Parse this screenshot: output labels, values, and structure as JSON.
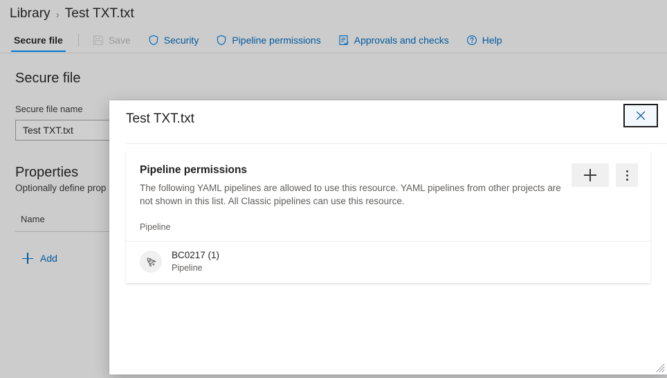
{
  "breadcrumb": {
    "root": "Library",
    "separator": "›",
    "current": "Test TXT.txt"
  },
  "commandbar": {
    "selected_tab": "Secure file",
    "items": [
      {
        "label": "Save",
        "icon": "save-icon",
        "disabled": true
      },
      {
        "label": "Security",
        "icon": "shield-icon",
        "disabled": false
      },
      {
        "label": "Pipeline permissions",
        "icon": "shield-icon",
        "disabled": false
      },
      {
        "label": "Approvals and checks",
        "icon": "approvals-icon",
        "disabled": false
      },
      {
        "label": "Help",
        "icon": "help-icon",
        "disabled": false
      }
    ]
  },
  "page": {
    "section_title": "Secure file",
    "file_name_label": "Secure file name",
    "file_name_value": "Test TXT.txt",
    "properties_title": "Properties",
    "properties_subtitle": "Optionally define prop",
    "properties_column_header": "Name",
    "add_label": "Add"
  },
  "dialog": {
    "title": "Test TXT.txt",
    "close_label": "Close",
    "permissions": {
      "heading": "Pipeline permissions",
      "description": "The following YAML pipelines are allowed to use this resource. YAML pipelines from other projects are not shown in this list. All Classic pipelines can use this resource.",
      "column_header": "Pipeline",
      "add_button_label": "Add pipeline",
      "more_button_label": "More options",
      "rows": [
        {
          "name": "BC0217 (1)",
          "subtitle": "Pipeline",
          "icon": "rocket-icon"
        }
      ]
    }
  },
  "colors": {
    "accent": "#0078d4",
    "link": "#005a9e",
    "page_background": "#cccccc",
    "dialog_background": "#ffffff",
    "muted_text": "#605e5c"
  }
}
